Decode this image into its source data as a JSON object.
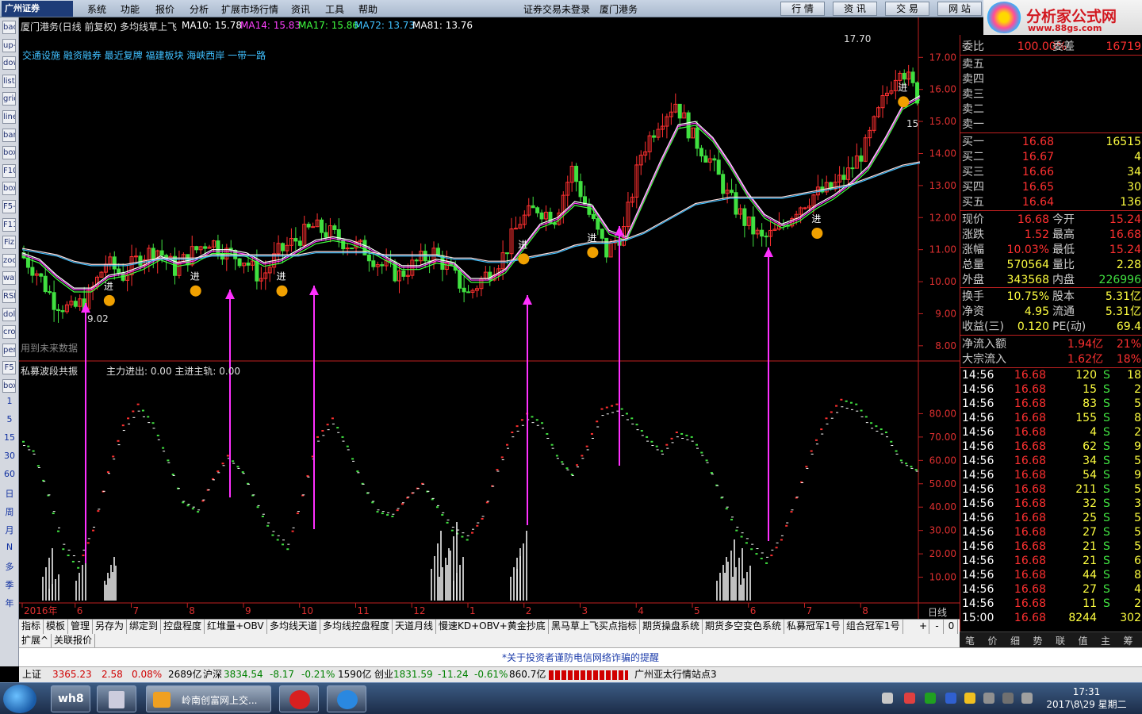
{
  "menu": {
    "logo": "广州证券",
    "items": [
      "系统",
      "功能",
      "报价",
      "分析",
      "扩展市场行情",
      "资讯",
      "工具",
      "帮助"
    ],
    "center_status": "证券交易未登录",
    "center_broker": "厦门港务",
    "right_buttons": [
      "行 情",
      "资 讯",
      "交 易",
      "网 站"
    ]
  },
  "brand": {
    "name": "分析家公式网",
    "url": "www.88gs.com"
  },
  "left_toolbar": {
    "period_labels": [
      "1",
      "5",
      "15",
      "30",
      "60",
      "日",
      "周",
      "月",
      "N",
      "多",
      "季",
      "年"
    ],
    "tool_icons": [
      "back-icon",
      "up-icon",
      "down-icon",
      "list-icon",
      "grid-icon",
      "line-chart-icon",
      "bar-chart-icon",
      "box-icon",
      "F10",
      "box2-icon",
      "F5-icon",
      "F11-icon",
      "Fiz",
      "zoom-icon",
      "wave-icon",
      "RSI",
      "dollar-icon",
      "cross-icon",
      "pen-icon",
      "F5",
      "box3-icon"
    ]
  },
  "chart": {
    "title": "厦门港务(日线 前复权) 多均线草上飞",
    "ma": [
      {
        "label": "MA10: 15.78",
        "color": "#ffffff"
      },
      {
        "label": "MA14: 15.83",
        "color": "#ff40ff"
      },
      {
        "label": "MA17: 15.86",
        "color": "#40ff40"
      },
      {
        "label": "MA72: 13.73",
        "color": "#40c0ff"
      },
      {
        "label": "MA81: 13.76",
        "color": "#ffffff"
      }
    ],
    "concepts": "交通设施 融资融券 最近复牌 福建板块 海峡西岸 一带一路",
    "future_data_note": "用到未来数据",
    "high_label": "17.70",
    "low_label": "9.02",
    "last_tick": "15",
    "jin_label": "进",
    "price_axis": [
      "17.00",
      "16.00",
      "15.00",
      "14.00",
      "13.00",
      "12.00",
      "11.00",
      "10.00",
      "9.00",
      "8.00"
    ],
    "indicator_title": "私募波段共振",
    "indicator_vals": "主力进出: 0.00  主进主轨: 0.00",
    "indicator_axis": [
      "80.00",
      "70.00",
      "60.00",
      "50.00",
      "40.00",
      "30.00",
      "20.00",
      "10.00"
    ],
    "date_axis": [
      "2016年",
      "6",
      "7",
      "8",
      "9",
      "10",
      "11",
      "12",
      "1",
      "2",
      "3",
      "4",
      "5",
      "6",
      "7",
      "8"
    ],
    "period": "日线",
    "colors": {
      "up": "#ff3030",
      "down": "#40e040",
      "accent": "#ff30ff",
      "line": "#ffffff"
    }
  },
  "chart_data": {
    "type": "candlestick",
    "title": "厦门港务(日线 前复权) 多均线草上飞",
    "x_labels": [
      "2016年",
      "6",
      "7",
      "8",
      "9",
      "10",
      "11",
      "12",
      "1",
      "2",
      "3",
      "4",
      "5",
      "6",
      "7",
      "8"
    ],
    "ylim": [
      7.6,
      17.8
    ],
    "price_path": [
      10.9,
      10.3,
      9.4,
      9.1,
      9.5,
      10.6,
      10.2,
      10.8,
      11.0,
      10.4,
      10.9,
      11.3,
      10.9,
      10.7,
      10.1,
      10.9,
      11.3,
      11.7,
      11.5,
      11.2,
      11.0,
      10.5,
      10.2,
      10.6,
      10.9,
      10.3,
      9.6,
      10.2,
      10.8,
      11.9,
      12.3,
      12.0,
      13.5,
      12.1,
      10.9,
      11.6,
      14.0,
      15.0,
      15.6,
      14.5,
      13.8,
      12.7,
      11.9,
      11.3,
      11.6,
      12.3,
      12.7,
      12.9,
      13.4,
      14.2,
      15.6,
      16.8,
      15.8
    ],
    "ma_short": [
      10.9,
      10.7,
      10.2,
      9.8,
      9.8,
      10.2,
      10.3,
      10.5,
      10.8,
      10.6,
      10.7,
      11.0,
      11.0,
      10.9,
      10.6,
      10.7,
      11.0,
      11.3,
      11.4,
      11.3,
      11.1,
      10.8,
      10.5,
      10.5,
      10.7,
      10.6,
      10.1,
      10.1,
      10.4,
      11.1,
      11.8,
      12.0,
      12.5,
      12.4,
      11.6,
      11.4,
      12.6,
      13.8,
      14.9,
      15.0,
      14.5,
      13.7,
      12.8,
      12.1,
      11.8,
      12.0,
      12.4,
      12.7,
      13.1,
      13.6,
      14.5,
      15.5,
      15.8
    ],
    "ma_long": [
      11.0,
      10.9,
      10.8,
      10.6,
      10.5,
      10.5,
      10.5,
      10.6,
      10.7,
      10.7,
      10.7,
      10.8,
      10.8,
      10.8,
      10.8,
      10.8,
      10.8,
      10.9,
      10.9,
      10.9,
      10.9,
      10.8,
      10.8,
      10.8,
      10.8,
      10.7,
      10.7,
      10.6,
      10.6,
      10.7,
      10.8,
      10.9,
      11.1,
      11.2,
      11.2,
      11.3,
      11.5,
      11.8,
      12.1,
      12.4,
      12.5,
      12.6,
      12.6,
      12.6,
      12.6,
      12.7,
      12.8,
      12.9,
      13.0,
      13.2,
      13.4,
      13.6,
      13.7
    ],
    "signals": [
      {
        "x": 5,
        "label": "进"
      },
      {
        "x": 10,
        "label": "进"
      },
      {
        "x": 15,
        "label": "进"
      },
      {
        "x": 29,
        "label": "进"
      },
      {
        "x": 33,
        "label": "进"
      },
      {
        "x": 46,
        "label": "进"
      },
      {
        "x": 51,
        "label": "进"
      }
    ],
    "indicator_main": [
      70,
      64,
      45,
      22,
      14,
      30,
      55,
      75,
      84,
      76,
      60,
      42,
      38,
      52,
      62,
      55,
      40,
      28,
      22,
      45,
      70,
      78,
      66,
      50,
      38,
      36,
      44,
      50,
      40,
      30,
      26,
      35,
      56,
      72,
      80,
      76,
      62,
      54,
      66,
      82,
      84,
      78,
      70,
      64,
      72,
      70,
      60,
      44,
      30,
      22,
      16,
      26,
      44,
      64,
      78,
      86,
      84,
      76,
      72,
      60,
      56
    ]
  },
  "quote_panel": {
    "weibi": {
      "label": "委比",
      "value": "100.00%",
      "label2": "委差",
      "value2": "16719"
    },
    "sell": [
      {
        "label": "卖五"
      },
      {
        "label": "卖四"
      },
      {
        "label": "卖三"
      },
      {
        "label": "卖二"
      },
      {
        "label": "卖一"
      }
    ],
    "buy": [
      {
        "label": "买一",
        "price": "16.68",
        "vol": "16515"
      },
      {
        "label": "买二",
        "price": "16.67",
        "vol": "4"
      },
      {
        "label": "买三",
        "price": "16.66",
        "vol": "34"
      },
      {
        "label": "买四",
        "price": "16.65",
        "vol": "30"
      },
      {
        "label": "买五",
        "price": "16.64",
        "vol": "136"
      }
    ],
    "stats": [
      {
        "l1": "现价",
        "v1": "16.68",
        "l2": "今开",
        "v2": "15.24"
      },
      {
        "l1": "涨跌",
        "v1": "1.52",
        "l2": "最高",
        "v2": "16.68"
      },
      {
        "l1": "涨幅",
        "v1": "10.03%",
        "l2": "最低",
        "v2": "15.24"
      },
      {
        "l1": "总量",
        "v1": "570564",
        "l2": "量比",
        "v2": "2.28"
      },
      {
        "l1": "外盘",
        "v1": "343568",
        "l2": "内盘",
        "v2": "226996"
      }
    ],
    "stats2": [
      {
        "l1": "换手",
        "v1": "10.75%",
        "l2": "股本",
        "v2": "5.31亿"
      },
      {
        "l1": "净资",
        "v1": "4.95",
        "l2": "流通",
        "v2": "5.31亿"
      },
      {
        "l1": "收益(三)",
        "v1": "0.120",
        "l2": "PE(动)",
        "v2": "69.4"
      }
    ],
    "flows": [
      {
        "label": "净流入额",
        "value": "1.94亿",
        "pct": "21%"
      },
      {
        "label": "大宗流入",
        "value": "1.62亿",
        "pct": "18%"
      }
    ],
    "ticks": [
      {
        "time": "14:56",
        "price": "16.68",
        "vol": "120",
        "side": "S",
        "n": "18"
      },
      {
        "time": "14:56",
        "price": "16.68",
        "vol": "15",
        "side": "S",
        "n": "2"
      },
      {
        "time": "14:56",
        "price": "16.68",
        "vol": "83",
        "side": "S",
        "n": "5"
      },
      {
        "time": "14:56",
        "price": "16.68",
        "vol": "155",
        "side": "S",
        "n": "8"
      },
      {
        "time": "14:56",
        "price": "16.68",
        "vol": "4",
        "side": "S",
        "n": "2"
      },
      {
        "time": "14:56",
        "price": "16.68",
        "vol": "62",
        "side": "S",
        "n": "9"
      },
      {
        "time": "14:56",
        "price": "16.68",
        "vol": "34",
        "side": "S",
        "n": "5"
      },
      {
        "time": "14:56",
        "price": "16.68",
        "vol": "54",
        "side": "S",
        "n": "9"
      },
      {
        "time": "14:56",
        "price": "16.68",
        "vol": "211",
        "side": "S",
        "n": "5"
      },
      {
        "time": "14:56",
        "price": "16.68",
        "vol": "32",
        "side": "S",
        "n": "3"
      },
      {
        "time": "14:56",
        "price": "16.68",
        "vol": "25",
        "side": "S",
        "n": "5"
      },
      {
        "time": "14:56",
        "price": "16.68",
        "vol": "27",
        "side": "S",
        "n": "5"
      },
      {
        "time": "14:56",
        "price": "16.68",
        "vol": "21",
        "side": "S",
        "n": "5"
      },
      {
        "time": "14:56",
        "price": "16.68",
        "vol": "21",
        "side": "S",
        "n": "6"
      },
      {
        "time": "14:56",
        "price": "16.68",
        "vol": "44",
        "side": "S",
        "n": "8"
      },
      {
        "time": "14:56",
        "price": "16.68",
        "vol": "27",
        "side": "S",
        "n": "4"
      },
      {
        "time": "14:56",
        "price": "16.68",
        "vol": "11",
        "side": "S",
        "n": "2"
      },
      {
        "time": "15:00",
        "price": "16.68",
        "vol": "8244",
        "side": "",
        "n": "302"
      }
    ],
    "tabs": [
      "笔",
      "价",
      "细",
      "势",
      "联",
      "值",
      "主",
      "筹"
    ]
  },
  "bottom_tabs": {
    "row1": [
      "指标",
      "模板",
      "管理",
      "另存为",
      "绑定到",
      "控盘程度",
      "红堆量+OBV",
      "多均线天道",
      "多均线控盘程度",
      "天道月线",
      "慢速KD+OBV+黄金抄底",
      "黑马草上飞买点指标",
      "期货操盘系统",
      "期货多空变色系统",
      "私募冠军1号",
      "组合冠军1号"
    ],
    "row2": [
      "扩展^",
      "关联报价"
    ],
    "controls": [
      "+",
      "-",
      "0"
    ]
  },
  "notice": "*关于投资者谨防电信网络诈骗的提醒",
  "status": {
    "sh_label": "上证",
    "sh_val": "3365.23",
    "sh_chg": "2.58",
    "sh_pct": "0.08%",
    "sh_amt": "2689亿",
    "sz_label": "沪深",
    "sz_val": "3834.54",
    "sz_chg": "-8.17",
    "sz_pct": "-0.21%",
    "sz_amt": "1590亿",
    "cy_label": "创业",
    "cy_val": "1831.59",
    "cy_chg": "-11.24",
    "cy_pct": "-0.61%",
    "cy_amt": "860.7亿",
    "station": "广州亚太行情站点3"
  },
  "taskbar": {
    "app_title": "岭南创富网上交...",
    "time": "17:31",
    "date": "2017\\8\\29 星期二",
    "wh8": "wh8"
  }
}
